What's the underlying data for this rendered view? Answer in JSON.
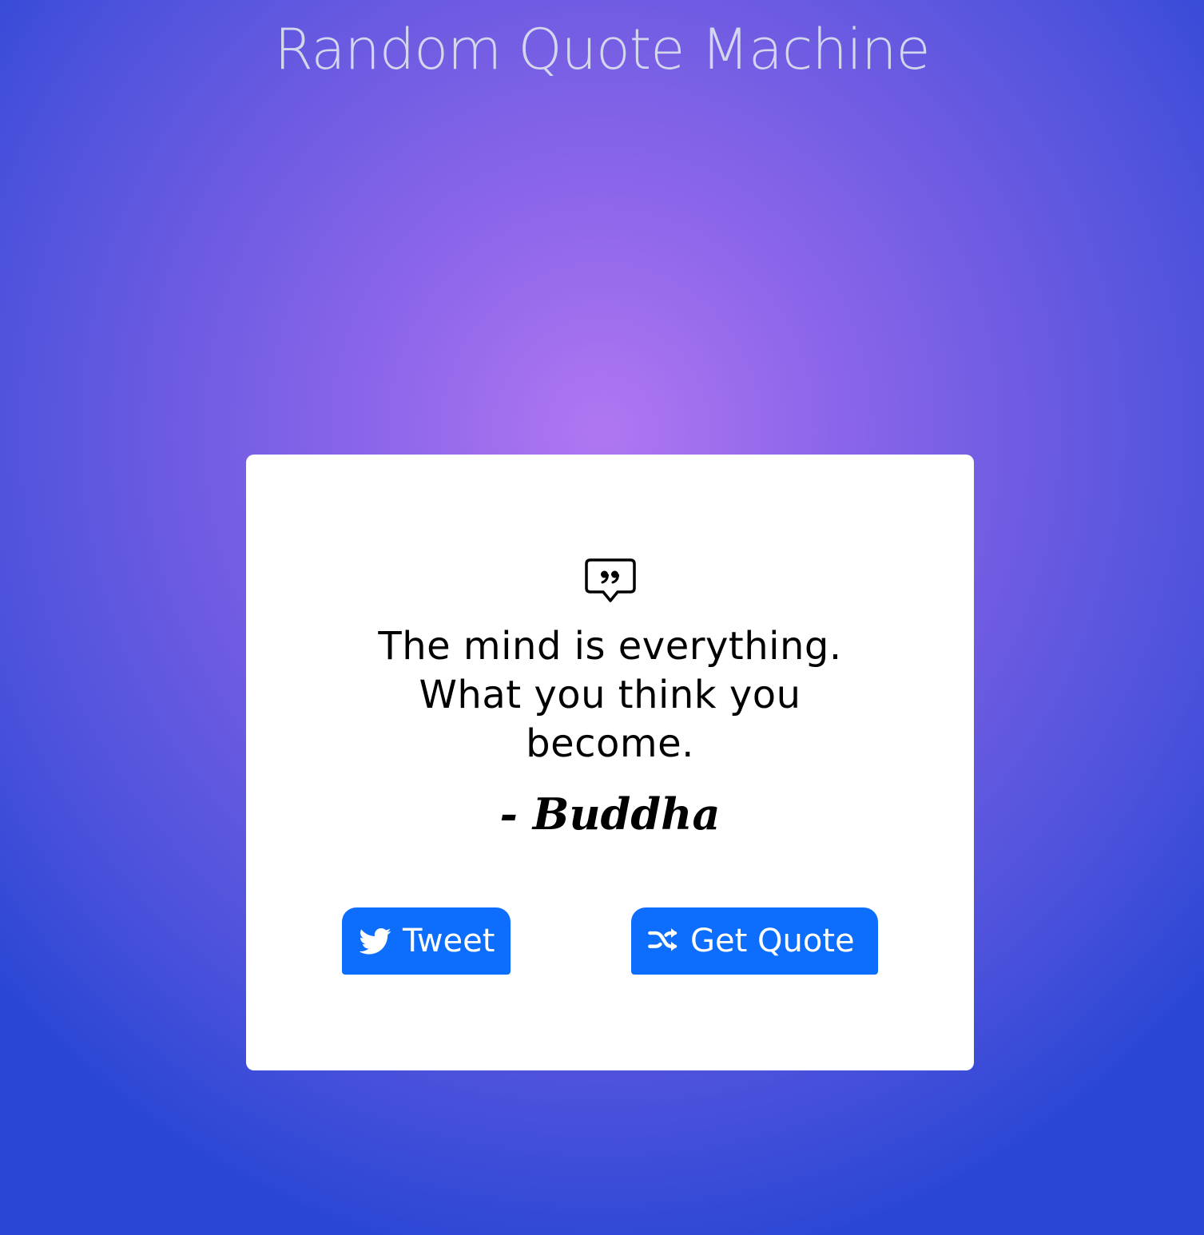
{
  "app": {
    "title": "Random Quote Machine"
  },
  "quote": {
    "icon": "quote-bubble-icon",
    "text": "The mind is everything. What you think you become.",
    "author": "- Buddha"
  },
  "actions": {
    "tweet_label": "Tweet",
    "tweet_icon": "twitter-icon",
    "new_quote_label": "Get Quote",
    "new_quote_icon": "shuffle-icon"
  },
  "colors": {
    "background_center": "#b077f2",
    "background_edge": "#2a47d4",
    "card": "#ffffff",
    "button": "#0d6efd",
    "title": "#d3d6ec",
    "text": "#000000"
  }
}
